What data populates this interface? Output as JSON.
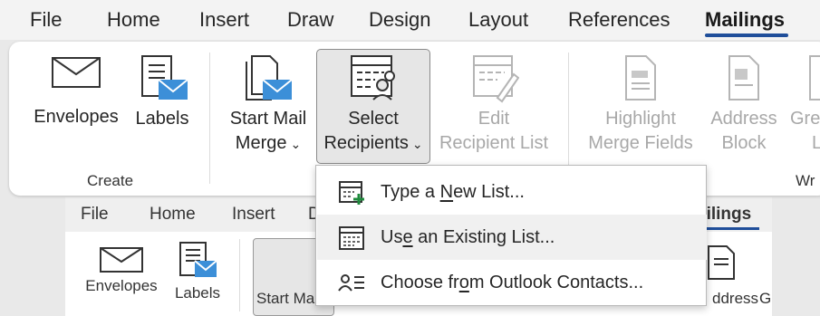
{
  "tabs": [
    "File",
    "Home",
    "Insert",
    "Draw",
    "Design",
    "Layout",
    "References",
    "Mailings"
  ],
  "active_tab": "Mailings",
  "ribbon": {
    "envelopes": "Envelopes",
    "labels": "Labels",
    "start_mail_merge_l1": "Start Mail",
    "start_mail_merge_l2": "Merge",
    "select_recipients_l1": "Select",
    "select_recipients_l2": "Recipients",
    "edit_recipient_list_l1": "Edit",
    "edit_recipient_list_l2": "Recipient List",
    "highlight_merge_fields_l1": "Highlight",
    "highlight_merge_fields_l2": "Merge Fields",
    "address_block_l1": "Address",
    "address_block_l2": "Block",
    "greeting_line_l1": "Gre",
    "greeting_line_l2": "L",
    "group_create": "Create",
    "group_write_partial": "Wr"
  },
  "background_ribbon": {
    "tabs": [
      "File",
      "Home",
      "Insert",
      "D"
    ],
    "active_tab_partial": "ailings",
    "envelopes": "Envelopes",
    "labels": "Labels",
    "start_mail_partial": "Start Ma",
    "address_partial": "ddress",
    "g_partial": "G"
  },
  "menu": {
    "items": [
      {
        "pre": "Type a ",
        "accel": "N",
        "post": "ew List...",
        "icon": "new-list-icon"
      },
      {
        "pre": "Us",
        "accel": "e",
        "post": " an Existing List...",
        "icon": "existing-list-icon"
      },
      {
        "pre": "Choose fr",
        "accel": "o",
        "post": "m Outlook Contacts...",
        "icon": "outlook-contacts-icon"
      }
    ]
  },
  "colors": {
    "accent": "#1f4e9a",
    "icon_blue": "#3c8fd8",
    "disabled": "#a8a8a8",
    "green_plus": "#1e8a3c"
  }
}
